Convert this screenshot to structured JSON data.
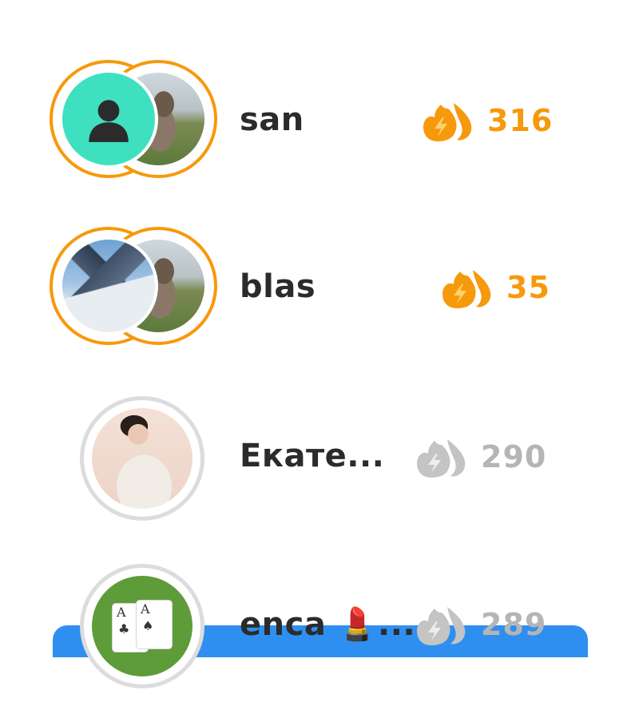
{
  "colors": {
    "streak_active": "#f7990c",
    "streak_inactive": "#b5b5b5",
    "bar_blue": "#2f8ff0",
    "avatar_teal": "#3fe0c0"
  },
  "friends": [
    {
      "name": "san",
      "streak": "316",
      "status": "active"
    },
    {
      "name": "blas",
      "streak": "35",
      "status": "active"
    },
    {
      "name": "Екате...",
      "streak": "290",
      "status": "inactive"
    },
    {
      "name": "enca 💄...",
      "streak": "289",
      "status": "inactive"
    }
  ],
  "icons": {
    "streak": "double-flame-lightning-icon",
    "placeholder_avatar": "person-silhouette-icon"
  }
}
